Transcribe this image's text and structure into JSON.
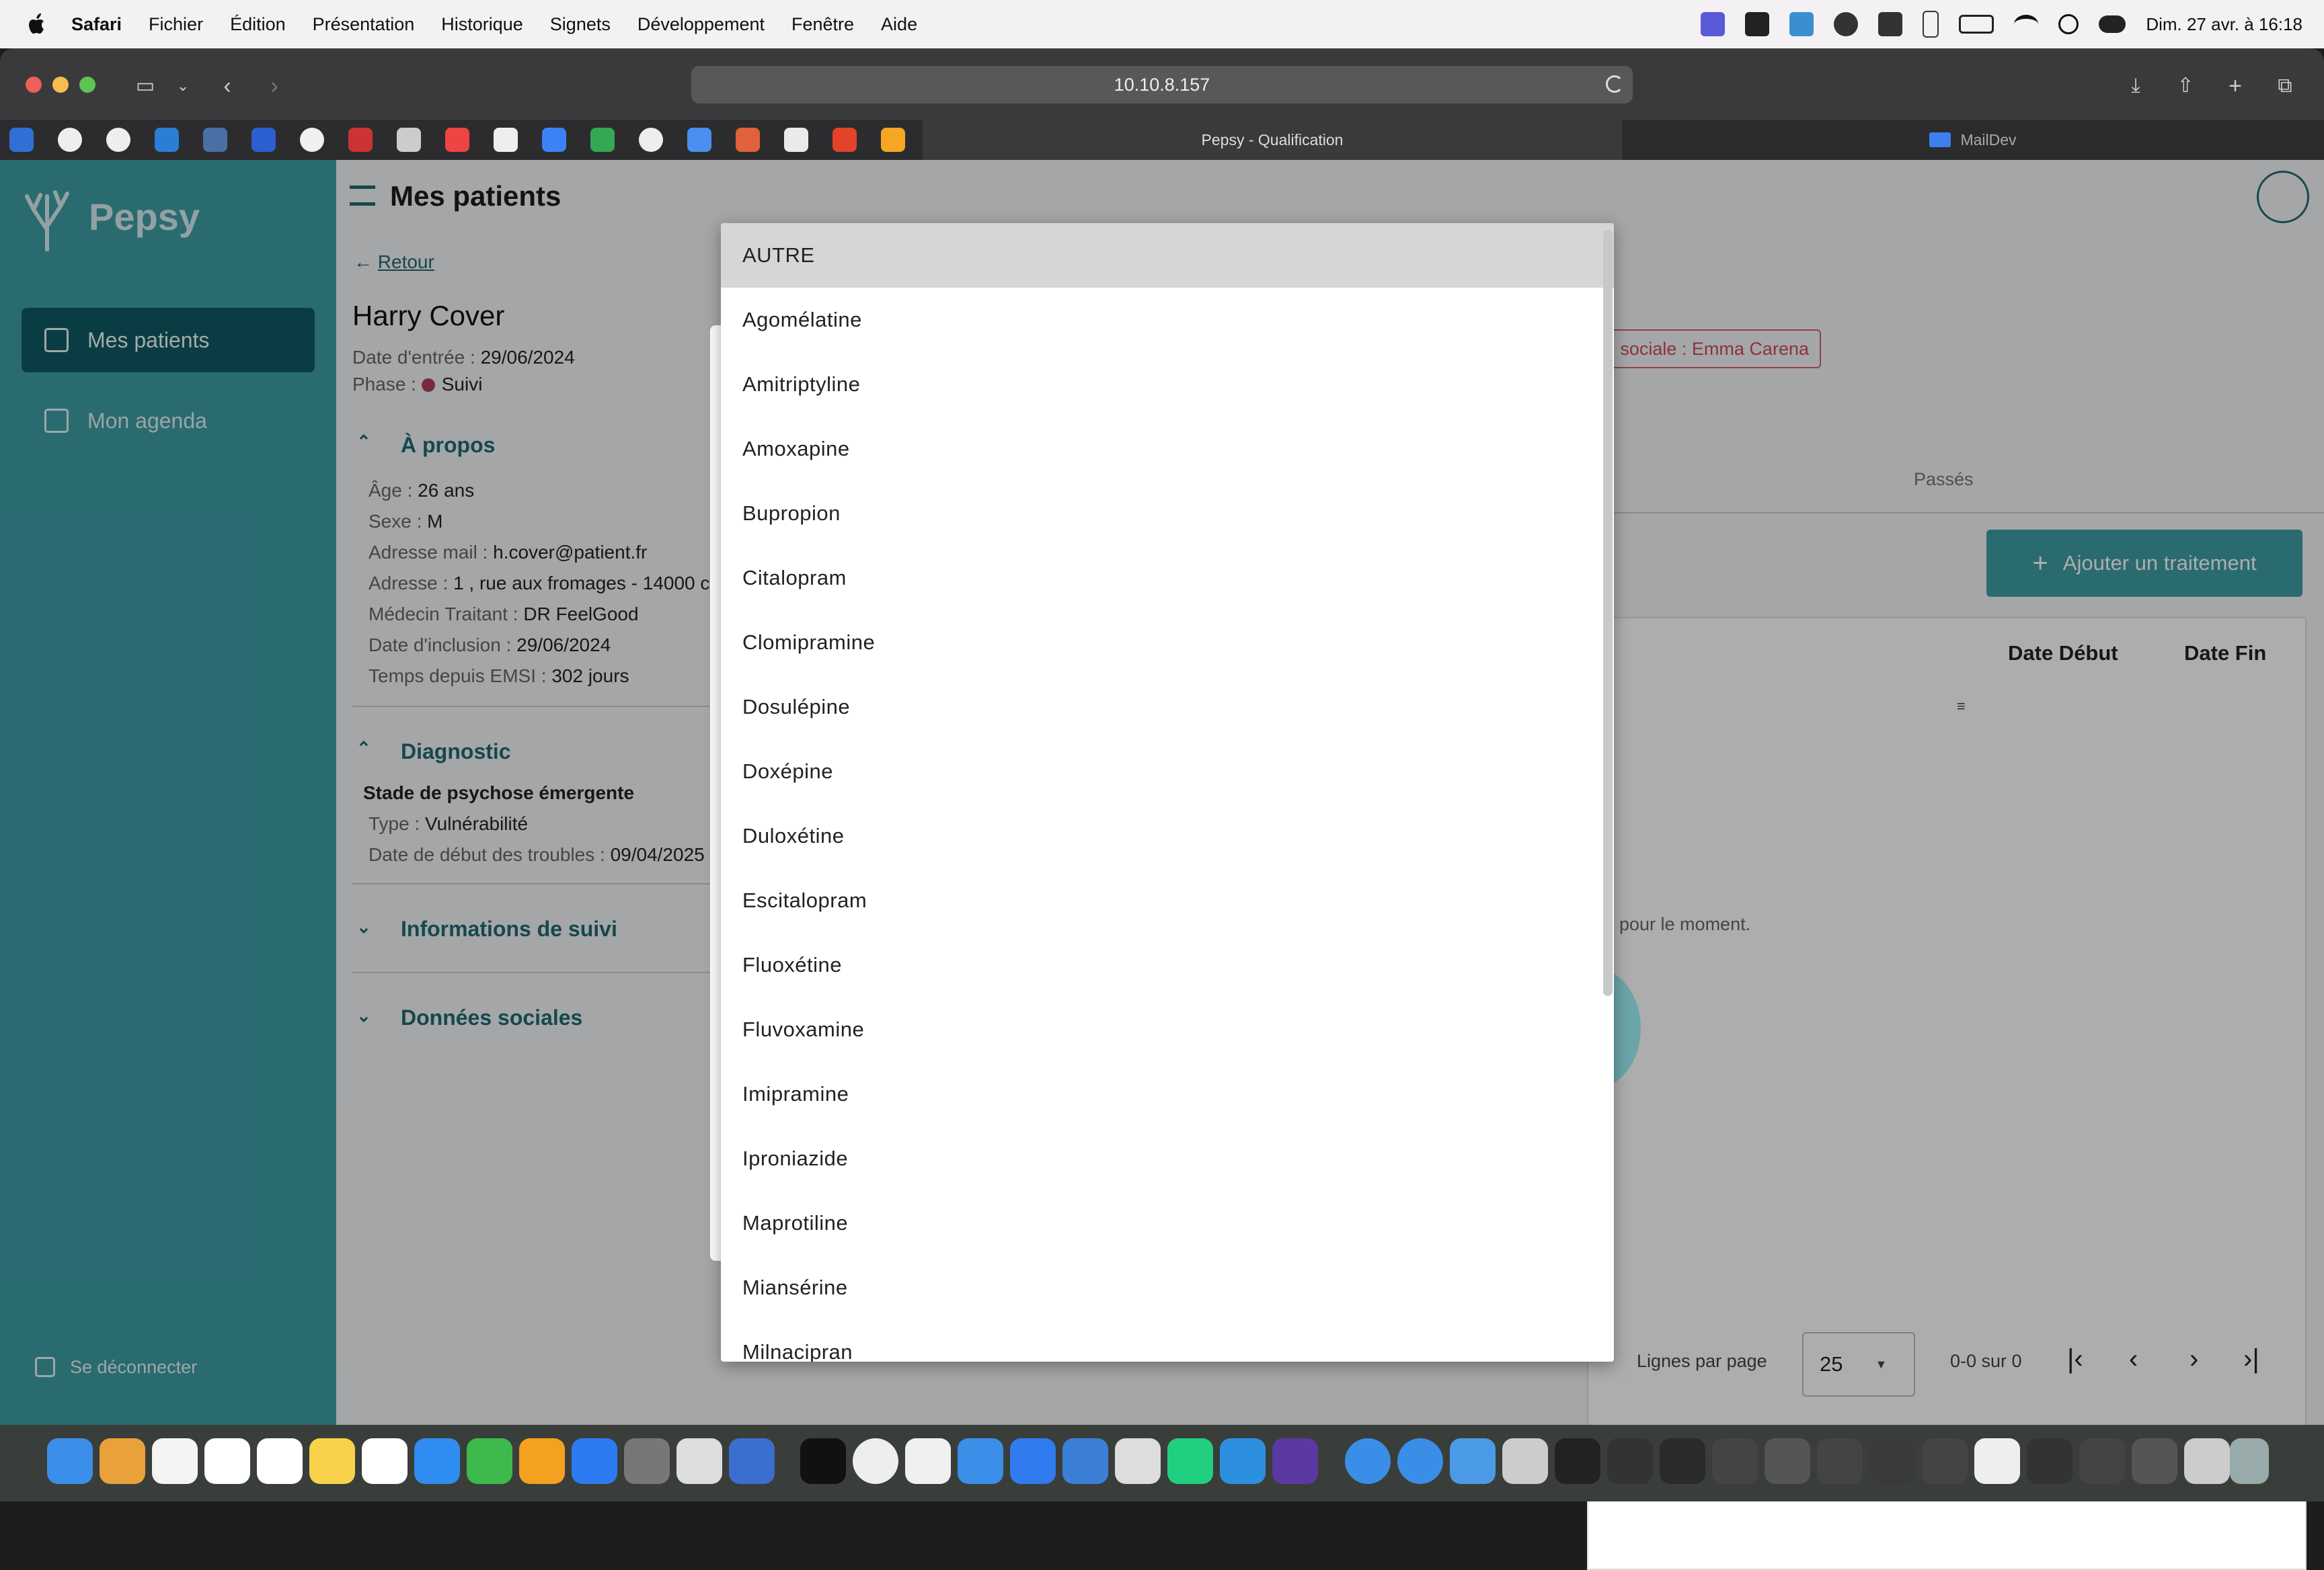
{
  "menubar": {
    "app": "Safari",
    "items": [
      "Fichier",
      "Édition",
      "Présentation",
      "Historique",
      "Signets",
      "Développement",
      "Fenêtre",
      "Aide"
    ],
    "datetime": "Dim. 27 avr. à 16:18"
  },
  "browser": {
    "url": "10.10.8.157",
    "tabs": [
      {
        "label": "Pepsy - Qualification",
        "active": true
      },
      {
        "label": "MailDev",
        "active": false
      }
    ]
  },
  "sidebar": {
    "brand": "Pepsy",
    "items": [
      {
        "label": "Mes patients",
        "active": true
      },
      {
        "label": "Mon agenda",
        "active": false
      }
    ],
    "logout": "Se déconnecter"
  },
  "page": {
    "title": "Mes patients",
    "back": "Retour",
    "patient_name": "Harry Cover",
    "entry_label": "Date d'entrée : ",
    "entry_value": "29/06/2024",
    "phase_label": "Phase : ",
    "phase_value": "Suivi",
    "social_chip": "sociale : Emma Carena",
    "tab_past": "Passés",
    "add_button": "Ajouter un traitement",
    "about": {
      "title": "À propos",
      "rows": [
        {
          "label": "Âge : ",
          "value": "26 ans"
        },
        {
          "label": "Sexe : ",
          "value": "M"
        },
        {
          "label": "Adresse mail : ",
          "value": "h.cover@patient.fr"
        },
        {
          "label": "Adresse : ",
          "value": "1 , rue aux fromages - 14000 c"
        },
        {
          "label": "Médecin Traitant : ",
          "value": "DR FeelGood"
        },
        {
          "label": "Date d'inclusion : ",
          "value": "29/06/2024"
        },
        {
          "label": "Temps depuis EMSI : ",
          "value": "302 jours"
        }
      ]
    },
    "diagnostic": {
      "title": "Diagnostic",
      "stage": "Stade de psychose émergente",
      "rows": [
        {
          "label": "Type : ",
          "value": "Vulnérabilité"
        },
        {
          "label": "Date de début des troubles : ",
          "value": "09/04/2025"
        }
      ]
    },
    "followup": "Informations de suivi",
    "social": "Données sociales",
    "table": {
      "columns": [
        "Date Début",
        "Date Fin"
      ],
      "empty": "pour le moment."
    },
    "pagination": {
      "rows_label": "Lignes par page",
      "rows_value": "25",
      "range": "0-0 sur 0"
    }
  },
  "dropdown": {
    "options": [
      "AUTRE",
      "Agomélatine",
      "Amitriptyline",
      "Amoxapine",
      "Bupropion",
      "Citalopram",
      "Clomipramine",
      "Dosulépine",
      "Doxépine",
      "Duloxétine",
      "Escitalopram",
      "Fluoxétine",
      "Fluvoxamine",
      "Imipramine",
      "Iproniazide",
      "Maprotiline",
      "Miansérine",
      "Milnacipran"
    ],
    "selected": "AUTRE"
  },
  "colors": {
    "primary": "#3f9ea6",
    "accent": "#1f6b74",
    "chip": "#e05a6a"
  }
}
